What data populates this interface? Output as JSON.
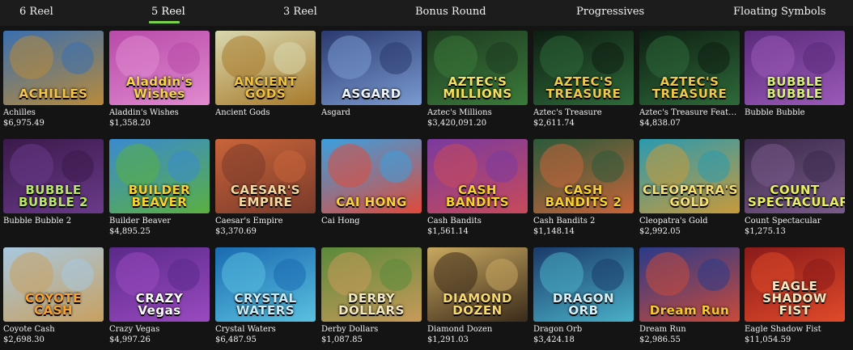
{
  "tabs": [
    {
      "label": "6 Reel",
      "active": false
    },
    {
      "label": "5 Reel",
      "active": true
    },
    {
      "label": "3 Reel",
      "active": false
    },
    {
      "label": "Bonus Round",
      "active": false
    },
    {
      "label": "Progressives",
      "active": false
    },
    {
      "label": "Floating Symbols",
      "active": false
    }
  ],
  "accent_color": "#7ad14a",
  "games": [
    {
      "name": "Achilles",
      "jackpot": "$6,975.49",
      "logo": "ACHILLES",
      "bg": [
        "#3a6fb0",
        "#b88a3a"
      ],
      "logo_color": "#f3c34a"
    },
    {
      "name": "Aladdin's Wishes",
      "jackpot": "$1,358.20",
      "logo": "Aladdin's Wishes",
      "bg": [
        "#b84aa8",
        "#e08ad0"
      ],
      "logo_color": "#f7d44a"
    },
    {
      "name": "Ancient Gods",
      "jackpot": "",
      "logo": "ANCIENT GODS",
      "bg": [
        "#d8d8b0",
        "#a87a2a"
      ],
      "logo_color": "#f0c040"
    },
    {
      "name": "Asgard",
      "jackpot": "",
      "logo": "ASGARD",
      "bg": [
        "#2a3a70",
        "#7a9ad0"
      ],
      "logo_color": "#eef4ff"
    },
    {
      "name": "Aztec's Millions",
      "jackpot": "$3,420,091.20",
      "logo": "AZTEC'S MILLIONS",
      "bg": [
        "#1e3a20",
        "#3a7a3a"
      ],
      "logo_color": "#f4e060"
    },
    {
      "name": "Aztec's Treasure",
      "jackpot": "$2,611.74",
      "logo": "AZTEC'S TREASURE",
      "bg": [
        "#0e1e12",
        "#2e6a3a"
      ],
      "logo_color": "#f0c848"
    },
    {
      "name": "Aztec's Treasure Feature Gua...",
      "jackpot": "$4,838.07",
      "logo": "AZTEC'S TREASURE",
      "bg": [
        "#0e1e12",
        "#2e6a3a"
      ],
      "logo_color": "#f0c848"
    },
    {
      "name": "Bubble Bubble",
      "jackpot": "",
      "logo": "BUBBLE BUBBLE",
      "bg": [
        "#5a2a7a",
        "#9a5ab8"
      ],
      "logo_color": "#d8f070"
    },
    {
      "name": "Bubble Bubble 2",
      "jackpot": "",
      "logo": "BUBBLE BUBBLE 2",
      "bg": [
        "#3a1a4a",
        "#6a3a8a"
      ],
      "logo_color": "#b8e860"
    },
    {
      "name": "Builder Beaver",
      "jackpot": "$4,895.25",
      "logo": "BUILDER BEAVER",
      "bg": [
        "#3a8ad0",
        "#5ab040"
      ],
      "logo_color": "#f8d030"
    },
    {
      "name": "Caesar's Empire",
      "jackpot": "$3,370.69",
      "logo": "CAESAR'S EMPIRE",
      "bg": [
        "#c8643a",
        "#7a3a2a"
      ],
      "logo_color": "#f4d8a0"
    },
    {
      "name": "Cai Hong",
      "jackpot": "",
      "logo": "CAI HONG",
      "bg": [
        "#3aa0e0",
        "#e04a3a"
      ],
      "logo_color": "#f8d040"
    },
    {
      "name": "Cash Bandits",
      "jackpot": "$1,561.14",
      "logo": "CASH BANDITS",
      "bg": [
        "#7a3aa0",
        "#c84a5a"
      ],
      "logo_color": "#f8d030"
    },
    {
      "name": "Cash Bandits 2",
      "jackpot": "$1,148.14",
      "logo": "CASH BANDITS 2",
      "bg": [
        "#2a5a3a",
        "#c8643a"
      ],
      "logo_color": "#f8d030"
    },
    {
      "name": "Cleopatra's Gold",
      "jackpot": "$2,992.05",
      "logo": "CLEOPATRA'S GOLD",
      "bg": [
        "#2a9ab0",
        "#c89a3a"
      ],
      "logo_color": "#f8e070"
    },
    {
      "name": "Count Spectacular",
      "jackpot": "$1,275.13",
      "logo": "COUNT SPECTACULAR",
      "bg": [
        "#3a2a4a",
        "#7a5a8a"
      ],
      "logo_color": "#e8f060"
    },
    {
      "name": "Coyote Cash",
      "jackpot": "$2,698.30",
      "logo": "COYOTE CASH",
      "bg": [
        "#a8c8e0",
        "#c8a060"
      ],
      "logo_color": "#f8a030"
    },
    {
      "name": "Crazy Vegas",
      "jackpot": "$4,997.26",
      "logo": "CRAZY Vegas",
      "bg": [
        "#5a2a8a",
        "#9a4ac0"
      ],
      "logo_color": "#ffffff"
    },
    {
      "name": "Crystal Waters",
      "jackpot": "$6,487.95",
      "logo": "CRYSTAL WATERS",
      "bg": [
        "#1a6ab0",
        "#5ac0e0"
      ],
      "logo_color": "#c8ecf8"
    },
    {
      "name": "Derby Dollars",
      "jackpot": "$1,087.85",
      "logo": "DERBY DOLLARS",
      "bg": [
        "#5a8a3a",
        "#c89a5a"
      ],
      "logo_color": "#f4e8c0"
    },
    {
      "name": "Diamond Dozen",
      "jackpot": "$1,291.03",
      "logo": "DIAMOND DOZEN",
      "bg": [
        "#c8a860",
        "#3a2a1a"
      ],
      "logo_color": "#f8d870"
    },
    {
      "name": "Dragon Orb",
      "jackpot": "$3,424.18",
      "logo": "DRAGON ORB",
      "bg": [
        "#1a3a6a",
        "#4ab0c8"
      ],
      "logo_color": "#d8f0f8"
    },
    {
      "name": "Dream Run",
      "jackpot": "$2,986.55",
      "logo": "Dream Run",
      "bg": [
        "#2a3a8a",
        "#c84a3a"
      ],
      "logo_color": "#f8c830"
    },
    {
      "name": "Eagle Shadow Fist",
      "jackpot": "$11,054.59",
      "logo": "EAGLE SHADOW FIST",
      "bg": [
        "#8a1a1a",
        "#e04a2a"
      ],
      "logo_color": "#f8e8c0"
    }
  ]
}
